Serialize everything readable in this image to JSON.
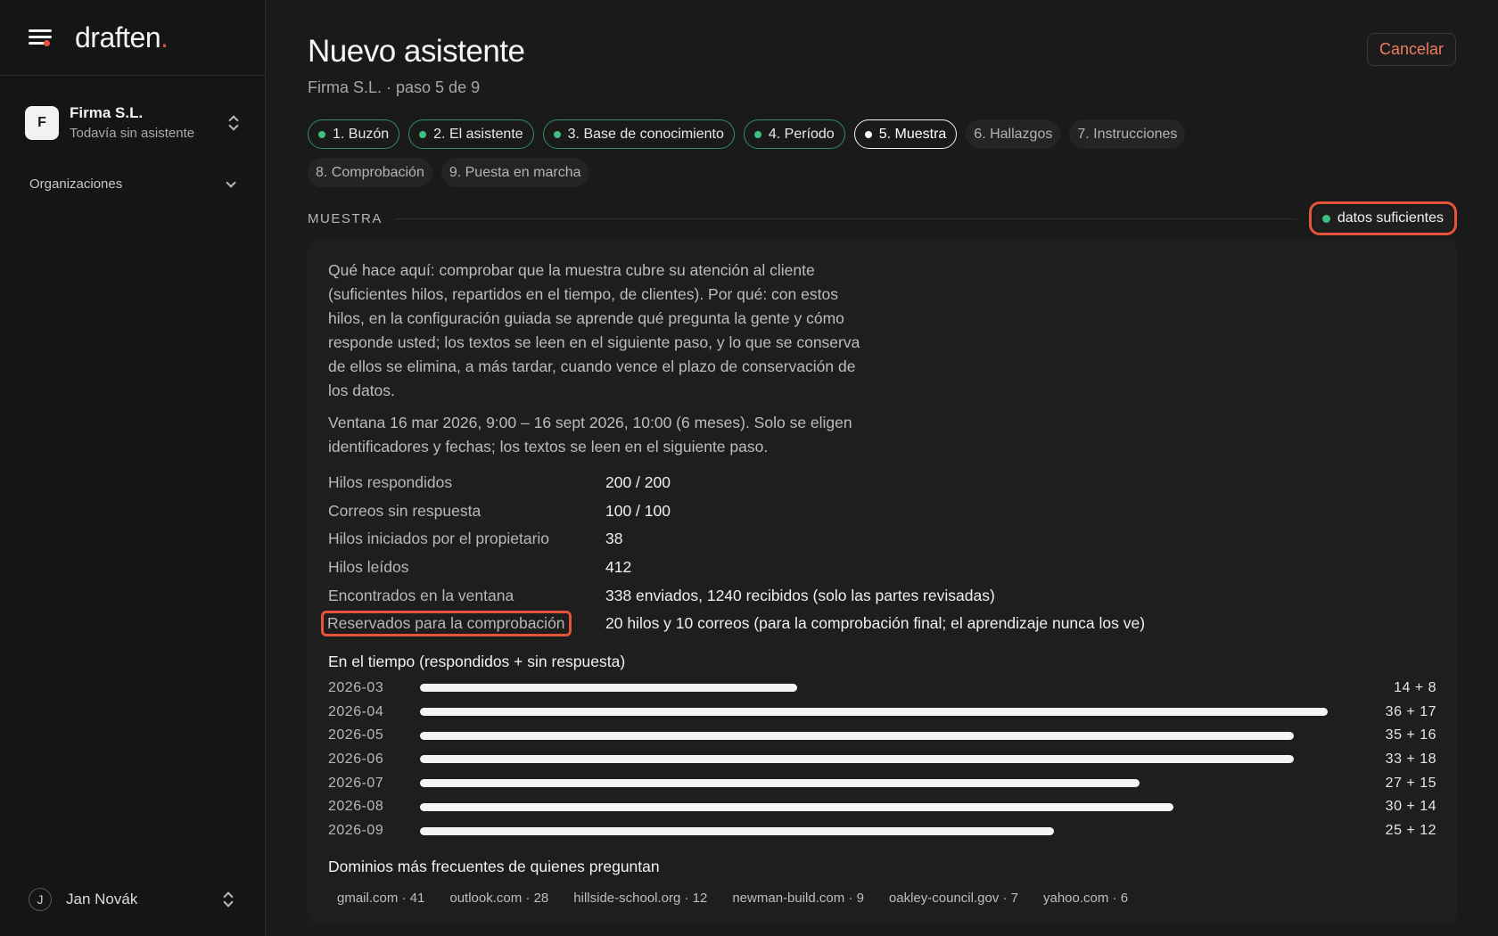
{
  "sidebar": {
    "logo": "draften",
    "logo_dot": ".",
    "org": {
      "initial": "F",
      "name": "Firma S.L.",
      "status": "Todavía sin asistente"
    },
    "organizations_label": "Organizaciones",
    "user": {
      "initial": "J",
      "name": "Jan Novák"
    }
  },
  "header": {
    "title": "Nuevo asistente",
    "subtitle": "Firma S.L. · paso 5 de 9",
    "cancel_label": "Cancelar"
  },
  "steps": [
    {
      "label": "1. Buzón",
      "state": "done"
    },
    {
      "label": "2. El asistente",
      "state": "done"
    },
    {
      "label": "3. Base de conocimiento",
      "state": "done"
    },
    {
      "label": "4. Período",
      "state": "done"
    },
    {
      "label": "5. Muestra",
      "state": "current"
    },
    {
      "label": "6. Hallazgos",
      "state": "todo"
    },
    {
      "label": "7. Instrucciones",
      "state": "todo"
    },
    {
      "label": "8. Comprobación",
      "state": "todo"
    },
    {
      "label": "9. Puesta en marcha",
      "state": "todo"
    }
  ],
  "section": {
    "label": "MUESTRA",
    "badge": "datos suficientes"
  },
  "description": [
    "Qué hace aquí: comprobar que la muestra cubre su atención al cliente (suficientes hilos, repartidos en el tiempo, de clientes). Por qué: con estos hilos, en la configuración guiada se aprende qué pregunta la gente y cómo responde usted; los textos se leen en el siguiente paso, y lo que se conserva de ellos se elimina, a más tardar, cuando vence el plazo de conservación de los datos.",
    "Ventana 16 mar 2026, 9:00 – 16 sept 2026, 10:00 (6 meses). Solo se eligen identificadores y fechas; los textos se leen en el siguiente paso."
  ],
  "stats": [
    {
      "label": "Hilos respondidos",
      "value": "200 / 200"
    },
    {
      "label": "Correos sin respuesta",
      "value": "100 / 100"
    },
    {
      "label": "Hilos iniciados por el propietario",
      "value": "38"
    },
    {
      "label": "Hilos leídos",
      "value": "412"
    },
    {
      "label": "Encontrados en la ventana",
      "value": "338 enviados, 1240 recibidos (solo las partes revisadas)"
    },
    {
      "label": "Reservados para la comprobación",
      "value": "20 hilos y 10 correos (para la comprobación final; el aprendizaje nunca los ve)",
      "highlight": true
    }
  ],
  "timeline": {
    "title": "En el tiempo (respondidos + sin respuesta)",
    "max_total": 53,
    "rows": [
      {
        "month": "2026-03",
        "answered": 14,
        "unanswered": 8,
        "label": "14 + 8"
      },
      {
        "month": "2026-04",
        "answered": 36,
        "unanswered": 17,
        "label": "36 + 17"
      },
      {
        "month": "2026-05",
        "answered": 35,
        "unanswered": 16,
        "label": "35 + 16"
      },
      {
        "month": "2026-06",
        "answered": 33,
        "unanswered": 18,
        "label": "33 + 18"
      },
      {
        "month": "2026-07",
        "answered": 27,
        "unanswered": 15,
        "label": "27 + 15"
      },
      {
        "month": "2026-08",
        "answered": 30,
        "unanswered": 14,
        "label": "30 + 14"
      },
      {
        "month": "2026-09",
        "answered": 25,
        "unanswered": 12,
        "label": "25 + 12"
      }
    ]
  },
  "domains": {
    "title": "Dominios más frecuentes de quienes preguntan",
    "items": [
      "gmail.com · 41",
      "outlook.com · 28",
      "hillside-school.org · 12",
      "newman-build.com · 9",
      "oakley-council.gov · 7",
      "yahoo.com · 6"
    ]
  },
  "colors": {
    "accent": "#e5533b",
    "success": "#3fbf7f",
    "background": "#1a1a1a"
  }
}
